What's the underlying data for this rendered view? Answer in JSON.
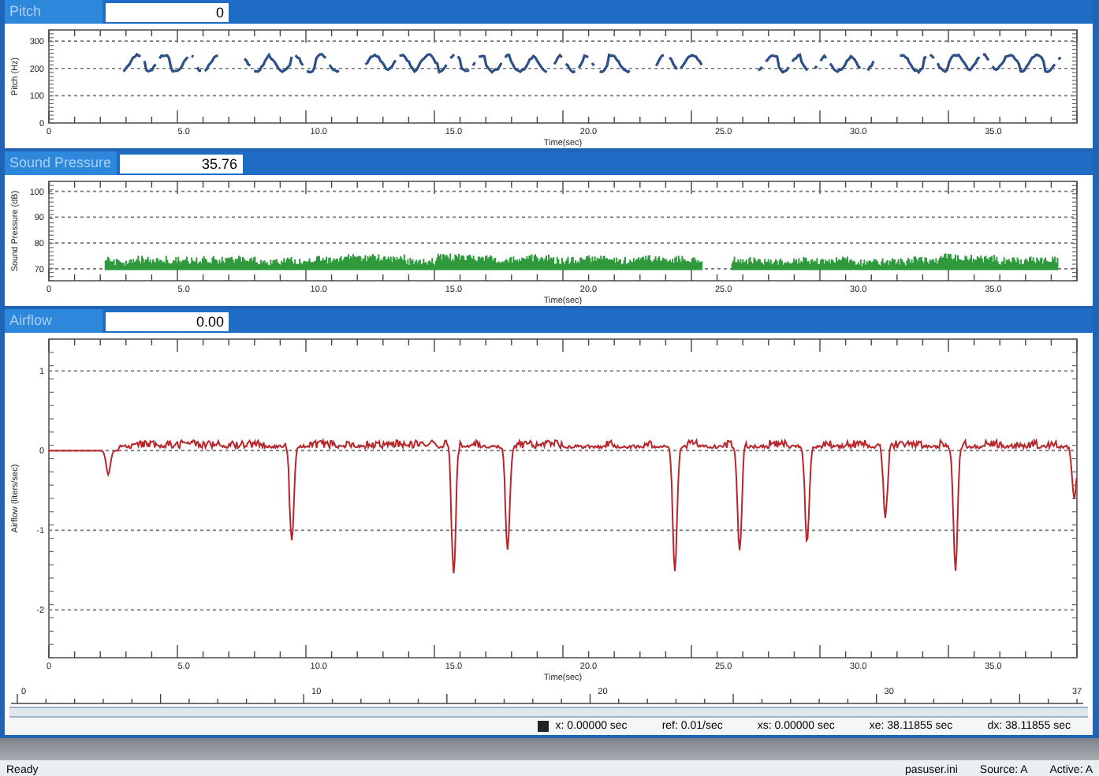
{
  "panels": [
    {
      "kind": "dots",
      "title": "Pitch",
      "value": "0",
      "color": "#2b4f86",
      "ylabel": "Pitch (Hz)",
      "yticks": [
        "300",
        "200",
        "100",
        "0"
      ],
      "xticks": [
        "0",
        "5.0",
        "10.0",
        "15.0",
        "20.0",
        "25.0",
        "30.0",
        "35.0"
      ],
      "xlabel": "Time(sec)"
    },
    {
      "kind": "bars",
      "title": "Sound Pressure",
      "value": "35.76",
      "color": "#2f9a3c",
      "ylabel": "Sound Pressure (dB)",
      "yticks": [
        "100",
        "90",
        "80",
        "70"
      ],
      "xticks": [
        "0",
        "5.0",
        "10.0",
        "15.0",
        "20.0",
        "25.0",
        "30.0",
        "35.0"
      ],
      "xlabel": "Time(sec)"
    },
    {
      "kind": "line",
      "title": "Airflow",
      "value": "0.00",
      "color": "#b8262c",
      "ylabel": "Airflow (liters/sec)",
      "yticks": [
        "1",
        "0",
        "-1",
        "-2"
      ],
      "xticks": [
        "0",
        "5.0",
        "10.0",
        "15.0",
        "20.0",
        "25.0",
        "30.0",
        "35.0"
      ],
      "xlabel": "Time(sec)"
    }
  ],
  "ruler": {
    "labels": [
      "0",
      "10",
      "20",
      "30",
      "37"
    ]
  },
  "readout": [
    "x: 0.00000 sec",
    "ref: 0.01/sec",
    "xs: 0.00000 sec",
    "xe: 38.11855 sec",
    "dx: 38.11855 sec"
  ],
  "status_bar": {
    "left": "Ready",
    "right": [
      "pasuser.ini",
      "Source: A",
      "Active: A"
    ]
  }
}
